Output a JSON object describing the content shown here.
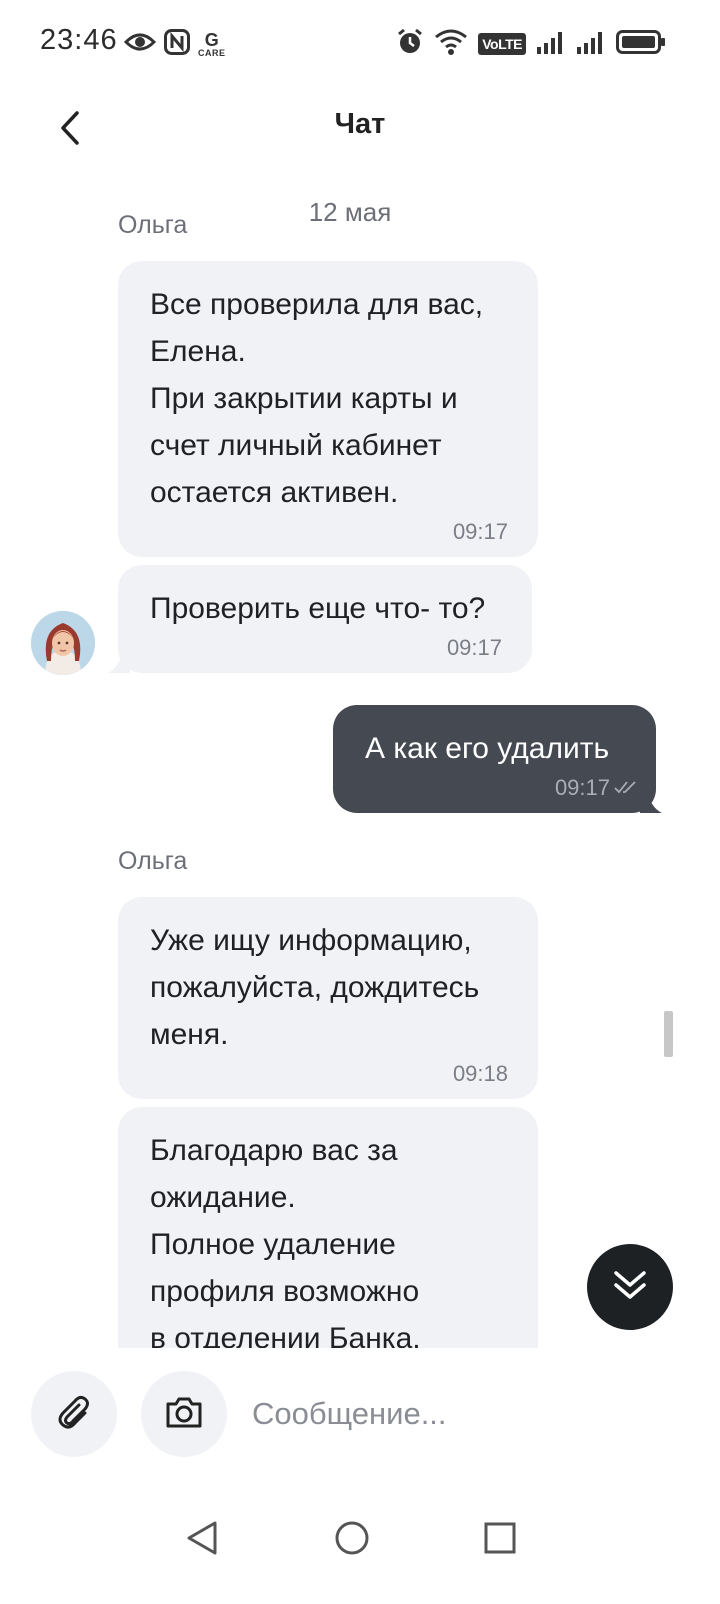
{
  "status_bar": {
    "time": "23:46",
    "care_top": "G",
    "care_bottom": "CARE",
    "volte": "VoLTE",
    "icons": [
      "eye-icon",
      "nfc-icon",
      "g-care-icon",
      "alarm-icon",
      "wifi-icon",
      "volte-icon",
      "signal-icon",
      "signal-icon",
      "battery-icon"
    ]
  },
  "header": {
    "title": "Чат",
    "back_icon": "chevron-left-icon"
  },
  "chat": {
    "date_separator": "12 мая",
    "groups": [
      {
        "sender": "Ольга",
        "messages": [
          {
            "text": "Все проверила для вас,\nЕлена.\nПри закрытии карты и\nсчет личный кабинет\nостается активен.",
            "time": "09:17"
          },
          {
            "text": "Проверить еще что- то?",
            "time": "09:17"
          }
        ]
      },
      {
        "outgoing": true,
        "messages": [
          {
            "text": "А как его удалить",
            "time": "09:17",
            "status": "read"
          }
        ]
      },
      {
        "sender": "Ольга",
        "messages": [
          {
            "text": "Уже ищу информацию,\nпожалуйста, дождитесь\nменя.",
            "time": "09:18"
          },
          {
            "text": "Благодарю вас за\nожидание.\nПолное удаление\nпрофиля возможно\nв отделении Банка,",
            "time": ""
          }
        ]
      }
    ]
  },
  "composer": {
    "attach_icon": "paperclip-icon",
    "camera_icon": "camera-icon",
    "placeholder": "Сообщение..."
  },
  "scroll_down_icon": "double-chevron-down-icon",
  "nav": {
    "icons": [
      "back-triangle-icon",
      "home-circle-icon",
      "recents-square-icon"
    ]
  },
  "colors": {
    "incoming_bubble": "#f1f2f6",
    "outgoing_bubble": "#454951",
    "scroll_button": "#1e2124",
    "secondary_text": "#6c6f78"
  }
}
